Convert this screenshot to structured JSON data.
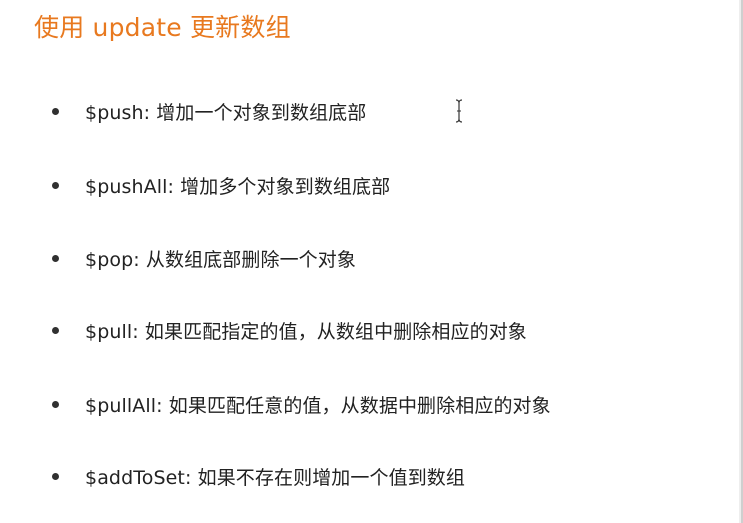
{
  "slide": {
    "title": "使用 update 更新数组",
    "title_color": "#e8791f",
    "bullets": [
      {
        "text": "$push: 增加一个对象到数组底部"
      },
      {
        "text": "$pushAll: 增加多个对象到数组底部"
      },
      {
        "text": "$pop: 从数组底部删除一个对象"
      },
      {
        "text": "$pull: 如果匹配指定的值，从数组中删除相应的对象"
      },
      {
        "text": "$pullAll: 如果匹配任意的值，从数据中删除相应的对象"
      },
      {
        "text": "$addToSet: 如果不存在则增加一个值到数组"
      }
    ],
    "cursor_icon": "text-cursor-icon"
  }
}
